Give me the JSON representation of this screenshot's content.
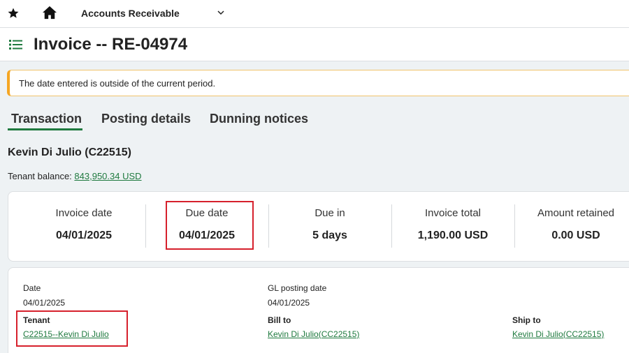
{
  "topbar": {
    "app_name": "Accounts Receivable"
  },
  "page": {
    "title": "Invoice -- RE-04974"
  },
  "alert": {
    "message": "The date entered is outside of the current period."
  },
  "tabs": [
    {
      "label": "Transaction",
      "active": true
    },
    {
      "label": "Posting details",
      "active": false
    },
    {
      "label": "Dunning notices",
      "active": false
    }
  ],
  "customer": {
    "name": "Kevin Di Julio (C22515)",
    "balance_label": "Tenant balance:",
    "balance_value": "843,950.34 USD"
  },
  "summary": [
    {
      "label": "Invoice date",
      "value": "04/01/2025"
    },
    {
      "label": "Due date",
      "value": "04/01/2025"
    },
    {
      "label": "Due in",
      "value": "5 days"
    },
    {
      "label": "Invoice total",
      "value": "1,190.00 USD"
    },
    {
      "label": "Amount retained",
      "value": "0.00 USD"
    }
  ],
  "details": {
    "date_label": "Date",
    "date_value": "04/01/2025",
    "gl_label": "GL posting date",
    "gl_value": "04/01/2025",
    "tenant_label": "Tenant",
    "tenant_value": "C22515--Kevin Di Julio",
    "billto_label": "Bill to",
    "billto_value": "Kevin Di Julio(CC22515)",
    "shipto_label": "Ship to",
    "shipto_value": "Kevin Di Julio(CC22515)"
  },
  "colors": {
    "accent_green": "#1f7a3f",
    "highlight_red": "#d6202c",
    "warning_orange": "#f5a623"
  }
}
